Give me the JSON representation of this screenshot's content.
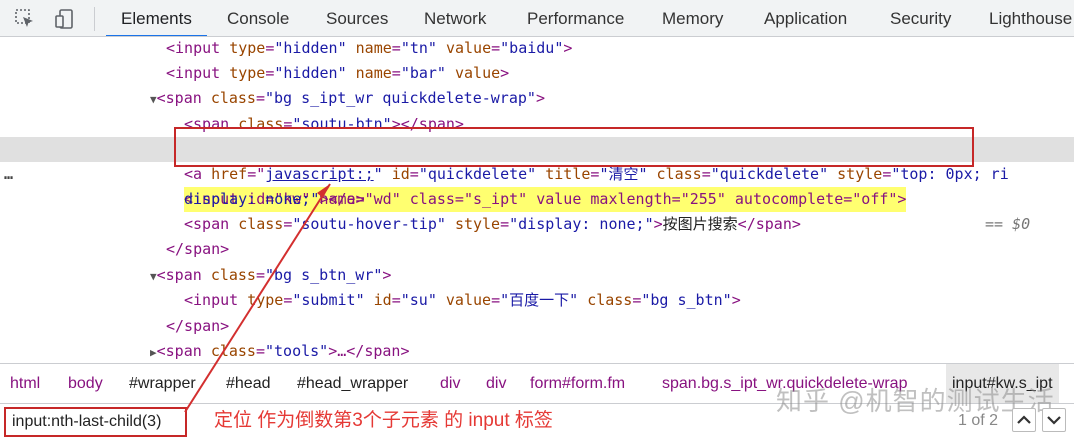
{
  "tabs": [
    "Elements",
    "Console",
    "Sources",
    "Network",
    "Performance",
    "Memory",
    "Application",
    "Security",
    "Lighthouse"
  ],
  "icons": {
    "inspect": "cursor-select-icon",
    "device": "device-toggle-icon"
  },
  "dom_lines": {
    "l1": {
      "tag": "<input",
      "a1": "type",
      "v1": "\"hidden\"",
      "a2": "name",
      "v2": "\"tn\"",
      "a3": "value",
      "v3": "\"baidu\"",
      "close": ">"
    },
    "l2": {
      "tag": "<input",
      "a1": "type",
      "v1": "\"hidden\"",
      "a2": "name",
      "v2": "\"bar\"",
      "a3": "value",
      "close": ">"
    },
    "l3": {
      "tag": "<span",
      "a1": "class",
      "v1": "\"bg s_ipt_wr quickdelete-wrap\"",
      "close": ">"
    },
    "l4": {
      "tag": "<span",
      "a1": "class",
      "v1": "\"soutu-btn\"",
      "close": "></span>"
    },
    "l5": {
      "dots": "…",
      "text": "<input id=\"kw\" name=\"wd\" class=\"s_ipt\" value maxlength=\"255\" autocomplete=\"off\">",
      "eq": "== $0"
    },
    "l6": {
      "tag": "<a",
      "a1": "href",
      "v1": "javascript:;",
      "a2": "id",
      "v2": "\"quickdelete\"",
      "a3": "title",
      "v3": "\"清空\"",
      "a4": "class",
      "v4": "\"quickdelete\"",
      "a5": "style",
      "v5": "\"top: 0px; ri"
    },
    "l7": {
      "v": "display: none;\"",
      "close": "></a>"
    },
    "l8": {
      "tag": "<span",
      "a1": "class",
      "v1": "\"soutu-hover-tip\"",
      "a2": "style",
      "v2": "\"display: none;\"",
      "close": ">",
      "text": "按图片搜索",
      "end": "</span>"
    },
    "l9": {
      "tag": "</span>"
    },
    "l10": {
      "tag": "<span",
      "a1": "class",
      "v1": "\"bg s_btn_wr\"",
      "close": ">"
    },
    "l11": {
      "tag": "<input",
      "a1": "type",
      "v1": "\"submit\"",
      "a2": "id",
      "v2": "\"su\"",
      "a3": "value",
      "v3": "\"百度一下\"",
      "a4": "class",
      "v4": "\"bg s_btn\"",
      "close": ">"
    },
    "l12": {
      "tag": "</span>"
    },
    "l13": {
      "tag": "<span",
      "a1": "class",
      "v1": "\"tools\"",
      "close": ">…</span>"
    }
  },
  "breadcrumbs": [
    "html",
    "body",
    "#wrapper",
    "#head",
    "#head_wrapper",
    "div",
    "div",
    "form#form.fm",
    "span.bg.s_ipt_wr.quickdelete-wrap",
    "input#kw.s_ipt"
  ],
  "search": {
    "value": "input:nth-last-child(3)",
    "match_count": "1 of 2"
  },
  "annotation": "定位 作为倒数第3个子元素 的 input 标签",
  "watermark": "知乎 @机智的测试生活",
  "colors": {
    "highlight_box": "#c62828",
    "annotation": "#e53935",
    "tag": "#881280",
    "attr_name": "#994500",
    "attr_value": "#1a1aa6"
  }
}
